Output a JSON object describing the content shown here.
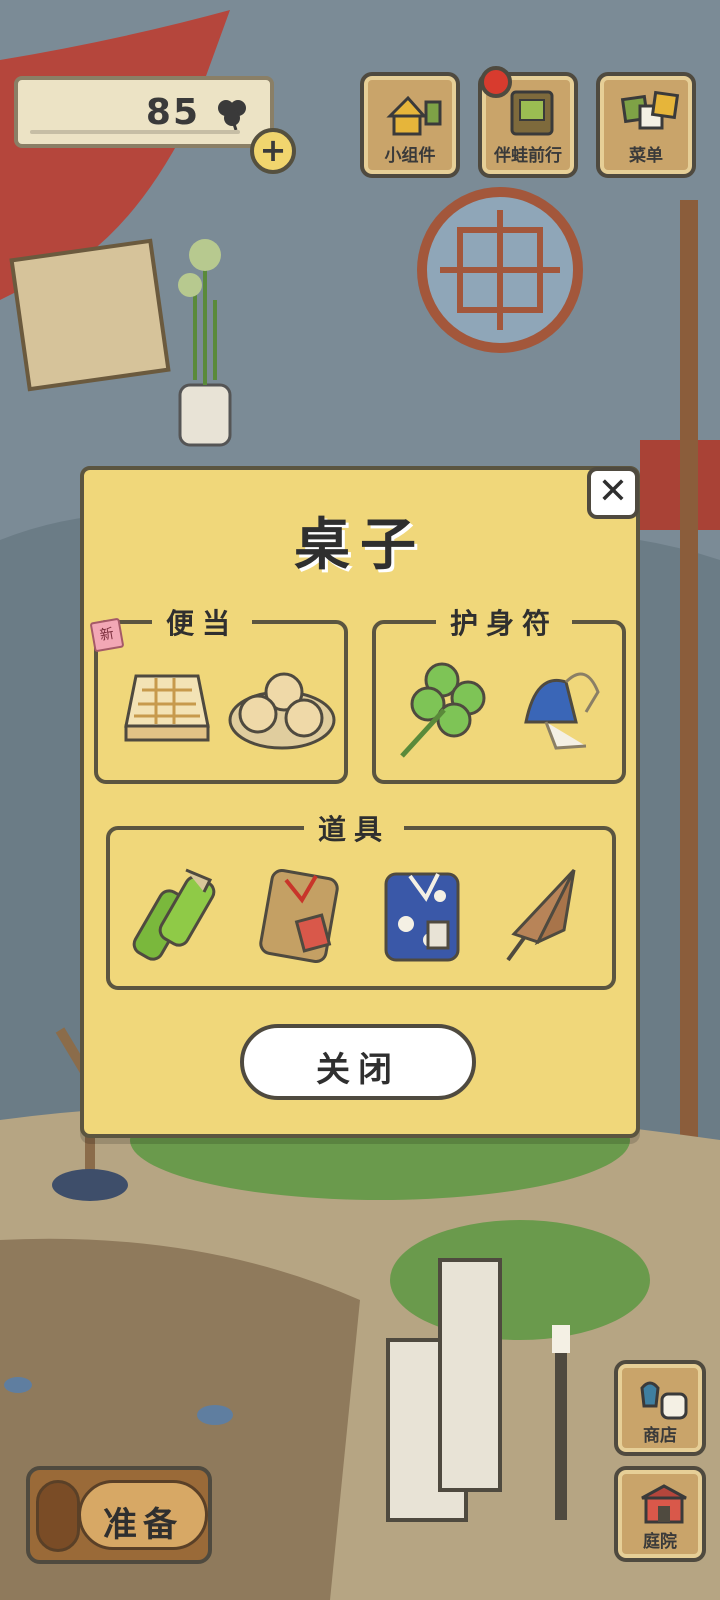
{
  "hud": {
    "clover_count": "85",
    "plus_label": "+"
  },
  "top_menu": [
    {
      "label": "小组件",
      "icon": "widget-icon"
    },
    {
      "label": "伴蛙前行",
      "icon": "frog-journey-icon"
    },
    {
      "label": "菜单",
      "icon": "menu-icon"
    }
  ],
  "side_menu": [
    {
      "label": "商店",
      "icon": "shop-icon"
    },
    {
      "label": "庭院",
      "icon": "garden-icon"
    }
  ],
  "prepare_button": {
    "label": "准备"
  },
  "dialog": {
    "title": "桌子",
    "close_x": "✕",
    "groups": [
      {
        "label": "便当",
        "items": [
          "sandwich-icon",
          "buns-plate-icon"
        ],
        "new_tag": "新"
      },
      {
        "label": "护身符",
        "items": [
          "four-leaf-clover-icon",
          "wind-chime-icon"
        ]
      },
      {
        "label": "道具",
        "items": [
          "bamboo-flask-icon",
          "brown-bundle-icon",
          "blue-bundle-icon",
          "paper-umbrella-icon"
        ]
      }
    ],
    "close_button": "关闭"
  },
  "colors": {
    "dialog_bg": "#f0d77a",
    "outline": "#5b5540",
    "button_wood": "#c9a46a",
    "notification": "#d83b2e"
  }
}
